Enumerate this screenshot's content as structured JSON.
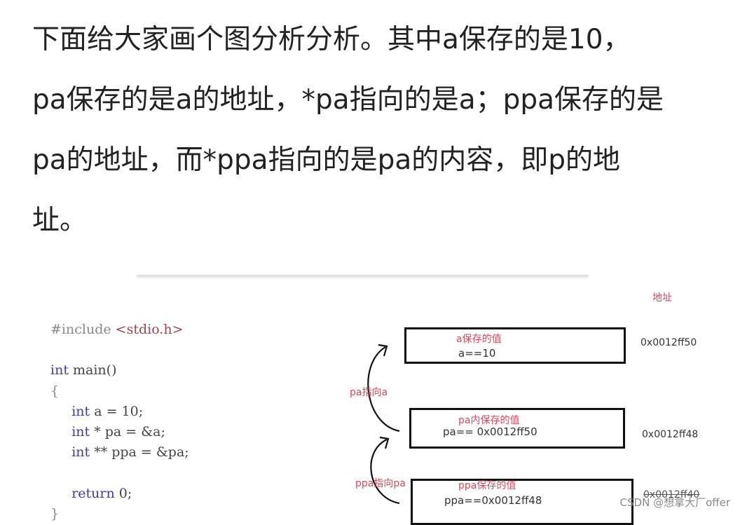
{
  "paragraph": {
    "lines": [
      "下面给大家画个图分析分析。其中a保存的是10，",
      "pa保存的是a的地址，*pa指向的是a；ppa保存的是",
      "pa的地址，而*ppa指向的是pa的内容，即p的地",
      "址。"
    ]
  },
  "code": {
    "include_directive": "#include",
    "include_header": "<stdio.h>",
    "main_type": "int",
    "main_sig": " main()",
    "open_brace": "{",
    "decl_a_type": "int",
    "decl_a_rest": " a = 10;",
    "decl_pa_type": "int",
    "decl_pa_rest": " * pa = &a;",
    "decl_ppa_type": "int",
    "decl_ppa_rest": " ** ppa = &pa;",
    "return_kw": "return",
    "return_rest": " 0;",
    "close_brace": "}"
  },
  "diagram": {
    "address_header": "地址",
    "boxes": [
      {
        "caption": "a保存的值",
        "value": "a==10",
        "address": "0x0012ff50"
      },
      {
        "caption": "pa内保存的值",
        "value": "pa==  0x0012ff50",
        "address": "0x0012ff48"
      },
      {
        "caption": "ppa保存的值",
        "value": "ppa==0x0012ff48",
        "address": "0x0012ff40"
      }
    ],
    "arrows": [
      {
        "label": "pa指向a"
      },
      {
        "label": "ppa指向pa"
      }
    ],
    "colors": {
      "annotation": "#e0455a",
      "box_border": "#111111",
      "keyword": "#3c3ca8"
    }
  },
  "watermark": "CSDN @想拿大厂offer"
}
